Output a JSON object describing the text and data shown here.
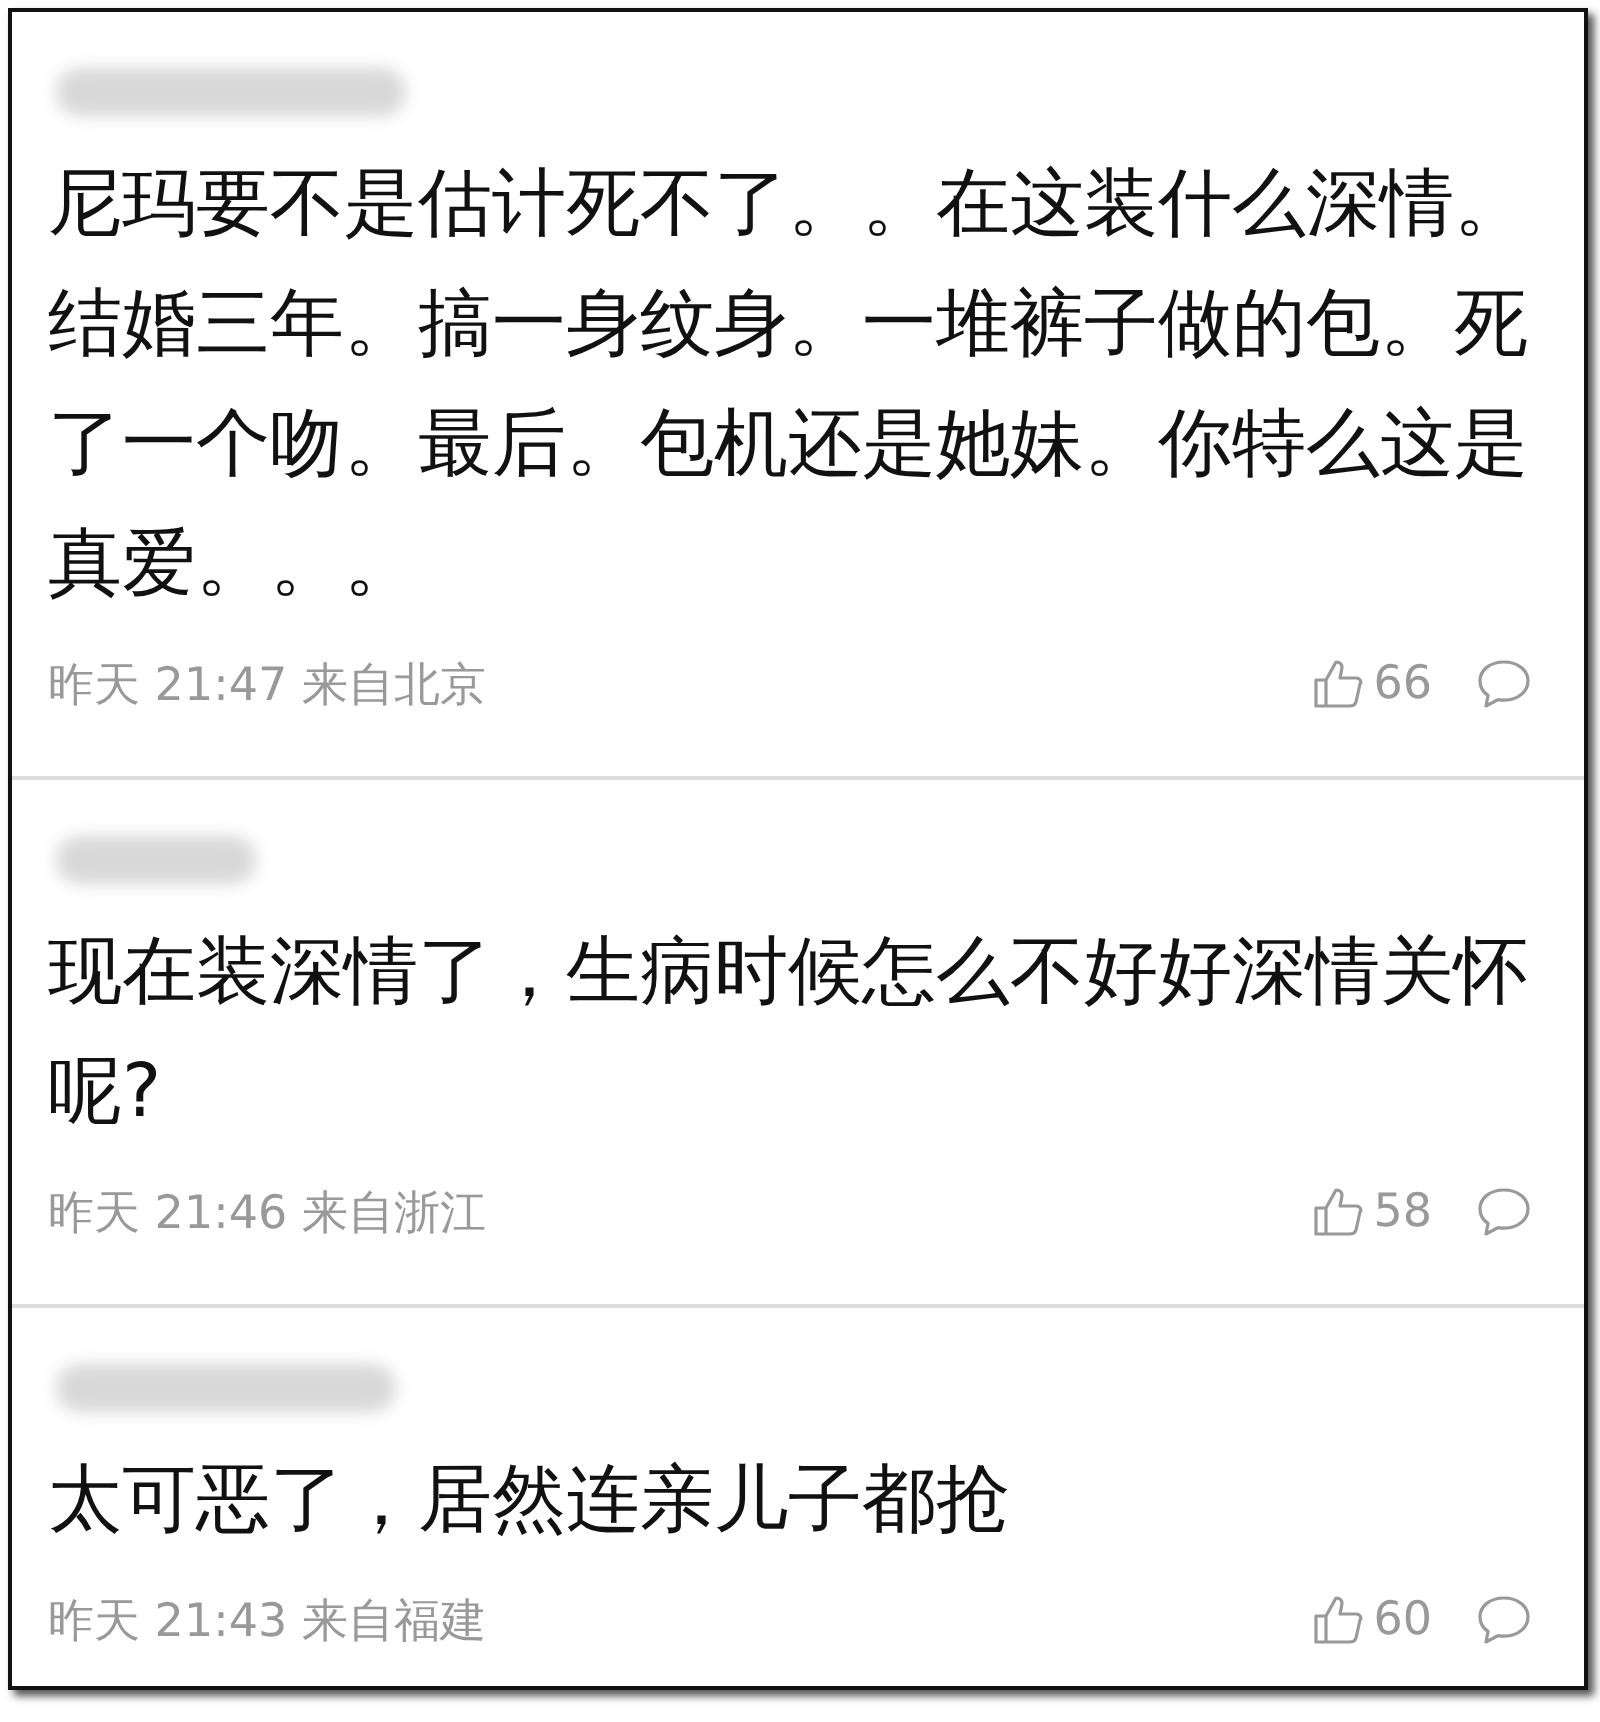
{
  "comments": [
    {
      "username_blurred": true,
      "text": "尼玛要不是估计死不了。。在这装什么深情。结婚三年。搞一身纹身。一堆裤子做的包。死了一个吻。最后。包机还是她妹。你特么这是真爱。。。",
      "time": "昨天 21:47 来自北京",
      "likes": "66"
    },
    {
      "username_blurred": true,
      "text": "现在装深情了，生病时候怎么不好好深情关怀呢?",
      "time": "昨天 21:46 来自浙江",
      "likes": "58"
    },
    {
      "username_blurred": true,
      "text": "太可恶了，居然连亲儿子都抢",
      "time": "昨天 21:43 来自福建",
      "likes": "60"
    }
  ]
}
